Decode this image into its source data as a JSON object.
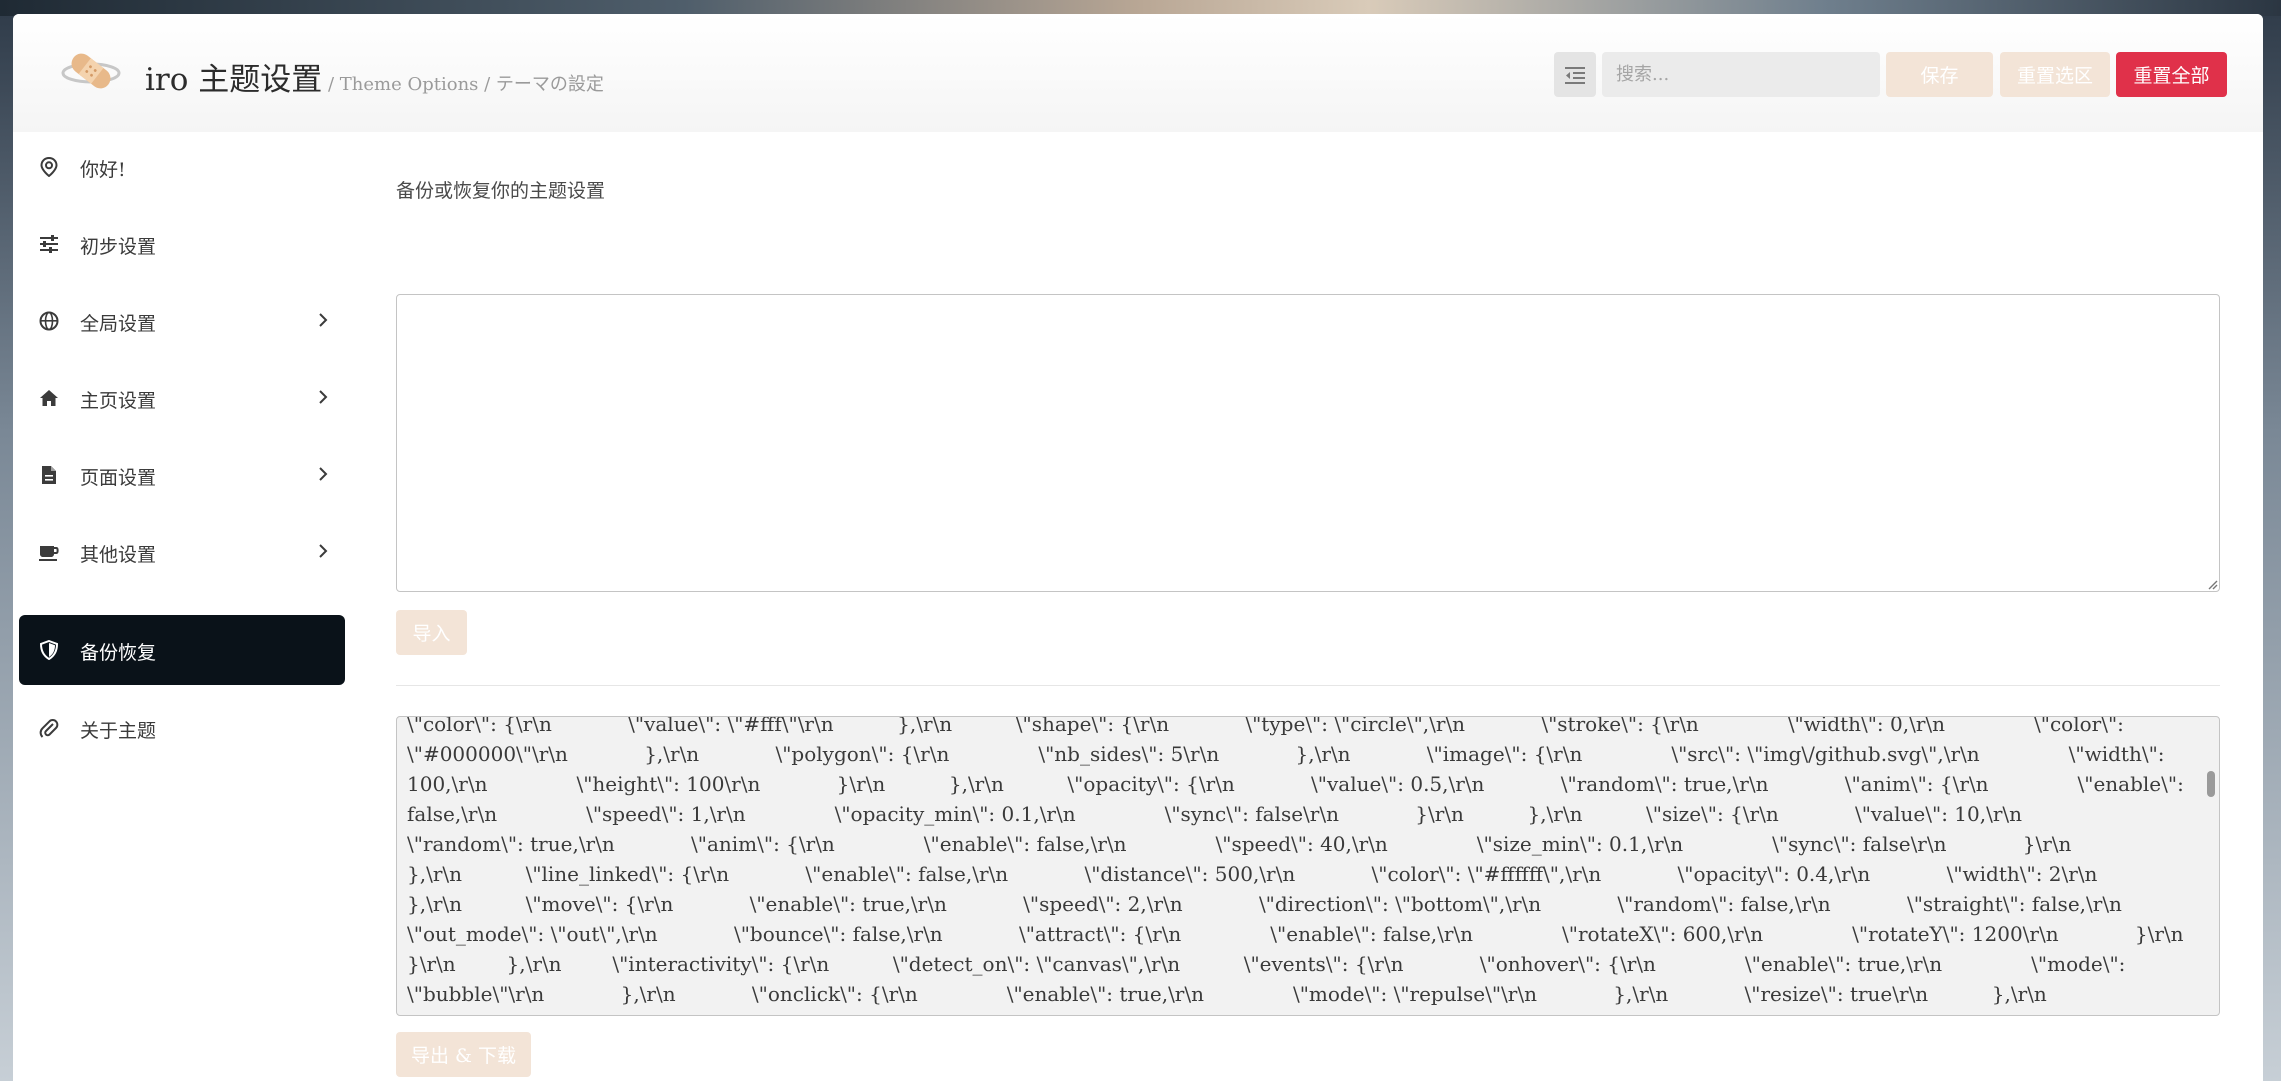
{
  "header": {
    "title": "iro 主题设置",
    "separator": " / ",
    "subtitle": "Theme Options / テーマの設定"
  },
  "toolbar": {
    "search_placeholder": "搜索...",
    "save_label": "保存",
    "reset_section_label": "重置选区",
    "reset_all_label": "重置全部"
  },
  "sidebar": {
    "items": [
      {
        "label": "你好!",
        "icon": "location-pin-icon",
        "has_submenu": false,
        "active": false
      },
      {
        "label": "初步设置",
        "icon": "sliders-icon",
        "has_submenu": false,
        "active": false
      },
      {
        "label": "全局设置",
        "icon": "globe-icon",
        "has_submenu": true,
        "active": false
      },
      {
        "label": "主页设置",
        "icon": "home-icon",
        "has_submenu": true,
        "active": false
      },
      {
        "label": "页面设置",
        "icon": "file-icon",
        "has_submenu": true,
        "active": false
      },
      {
        "label": "其他设置",
        "icon": "coffee-icon",
        "has_submenu": true,
        "active": false
      },
      {
        "label": "备份恢复",
        "icon": "shield-icon",
        "has_submenu": false,
        "active": true
      },
      {
        "label": "关于主题",
        "icon": "paperclip-icon",
        "has_submenu": false,
        "active": false
      }
    ]
  },
  "main": {
    "description": "备份或恢复你的主题设置",
    "import_value": "",
    "import_button": "导入",
    "export_text": "\\\"color\\\": {\\r\\n            \\\"value\\\": \\\"#fff\\\"\\r\\n          },\\r\\n          \\\"shape\\\": {\\r\\n            \\\"type\\\": \\\"circle\\\",\\r\\n            \\\"stroke\\\": {\\r\\n              \\\"width\\\": 0,\\r\\n              \\\"color\\\": \\\"#000000\\\"\\r\\n            },\\r\\n            \\\"polygon\\\": {\\r\\n              \\\"nb_sides\\\": 5\\r\\n            },\\r\\n            \\\"image\\\": {\\r\\n              \\\"src\\\": \\\"img\\/github.svg\\\",\\r\\n              \\\"width\\\": 100,\\r\\n              \\\"height\\\": 100\\r\\n            }\\r\\n          },\\r\\n          \\\"opacity\\\": {\\r\\n            \\\"value\\\": 0.5,\\r\\n            \\\"random\\\": true,\\r\\n            \\\"anim\\\": {\\r\\n              \\\"enable\\\": false,\\r\\n              \\\"speed\\\": 1,\\r\\n              \\\"opacity_min\\\": 0.1,\\r\\n              \\\"sync\\\": false\\r\\n            }\\r\\n          },\\r\\n          \\\"size\\\": {\\r\\n            \\\"value\\\": 10,\\r\\n            \\\"random\\\": true,\\r\\n            \\\"anim\\\": {\\r\\n              \\\"enable\\\": false,\\r\\n              \\\"speed\\\": 40,\\r\\n              \\\"size_min\\\": 0.1,\\r\\n              \\\"sync\\\": false\\r\\n            }\\r\\n          },\\r\\n          \\\"line_linked\\\": {\\r\\n            \\\"enable\\\": false,\\r\\n            \\\"distance\\\": 500,\\r\\n            \\\"color\\\": \\\"#ffffff\\\",\\r\\n            \\\"opacity\\\": 0.4,\\r\\n            \\\"width\\\": 2\\r\\n          },\\r\\n          \\\"move\\\": {\\r\\n            \\\"enable\\\": true,\\r\\n            \\\"speed\\\": 2,\\r\\n            \\\"direction\\\": \\\"bottom\\\",\\r\\n            \\\"random\\\": false,\\r\\n            \\\"straight\\\": false,\\r\\n            \\\"out_mode\\\": \\\"out\\\",\\r\\n            \\\"bounce\\\": false,\\r\\n            \\\"attract\\\": {\\r\\n              \\\"enable\\\": false,\\r\\n              \\\"rotateX\\\": 600,\\r\\n              \\\"rotateY\\\": 1200\\r\\n            }\\r\\n          }\\r\\n        },\\r\\n        \\\"interactivity\\\": {\\r\\n          \\\"detect_on\\\": \\\"canvas\\\",\\r\\n          \\\"events\\\": {\\r\\n            \\\"onhover\\\": {\\r\\n              \\\"enable\\\": true,\\r\\n              \\\"mode\\\": \\\"bubble\\\"\\r\\n            },\\r\\n            \\\"onclick\\\": {\\r\\n              \\\"enable\\\": true,\\r\\n              \\\"mode\\\": \\\"repulse\\\"\\r\\n            },\\r\\n            \\\"resize\\\": true\\r\\n          },\\r\\n          \\\"modes\\\": {",
    "export_button": "导出 & 下载"
  },
  "colors": {
    "accent_light": "#f3e4d7",
    "danger": "#e0314a",
    "active_nav": "#0a1219"
  }
}
